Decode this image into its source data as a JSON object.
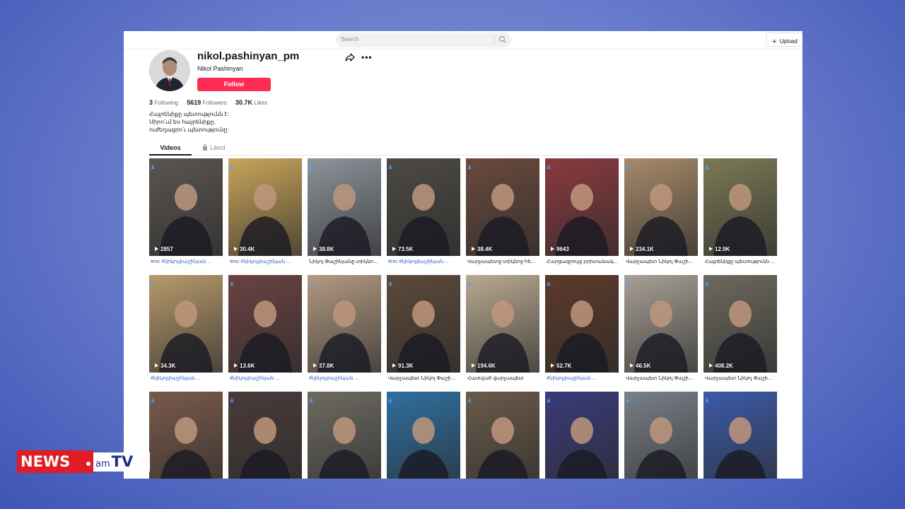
{
  "search": {
    "placeholder": "Search"
  },
  "header": {
    "upload_label": "Upload"
  },
  "profile": {
    "username": "nikol.pashinyan_pm",
    "nickname": "Nikol Pashinyan",
    "follow_label": "Follow",
    "stats": {
      "following_count": "3",
      "following_label": "Following",
      "followers_count": "5619",
      "followers_label": "Followers",
      "likes_count": "30.7K",
      "likes_label": "Likes"
    },
    "bio": [
      "Հայրենիքը պետությունն է:",
      "Սիրո՛ւմ ես հայրենիքը,",
      "ուժեղացրո՛ւ պետությունը:"
    ]
  },
  "tabs": {
    "videos": "Videos",
    "liked": "Liked"
  },
  "videos": [
    {
      "views": "2857",
      "caption": "#rec #նիկոլփաշինյան ...",
      "bg": "#5a5550"
    },
    {
      "views": "30.4K",
      "caption": "#rec #նիկոլփաշինյան ...",
      "bg": "#c9a55a"
    },
    {
      "views": "38.8K",
      "caption": "Նիկոլ Փաշինյանը տիկնո...",
      "bg": "#8e949c"
    },
    {
      "views": "73.5K",
      "caption": "#rec #նիկոլփաշինյան ...",
      "bg": "#4d4a44"
    },
    {
      "views": "38.4K",
      "caption": "Վարչապետը տիկնոջ հե...",
      "bg": "#6a4a3c"
    },
    {
      "views": "9643",
      "caption": "Հարցազրույց բրիտանակ...",
      "bg": "#8a3a3f"
    },
    {
      "views": "234.1K",
      "caption": "Վարչապետ Նիկոլ Փաշի...",
      "bg": "#a78a6a"
    },
    {
      "views": "12.9K",
      "caption": "Հայրենիքը պետությունն ...",
      "bg": "#7b7a55"
    },
    {
      "views": "34.3K",
      "caption": "#նիկոլփաշինյան ...",
      "bg": "#b89a6c"
    },
    {
      "views": "13.6K",
      "caption": "#նիկոլփաշինյան ...",
      "bg": "#6b4242"
    },
    {
      "views": "37.8K",
      "caption": "#նիկոլփաշինյան ...",
      "bg": "#b39a82"
    },
    {
      "views": "91.3K",
      "caption": "Վարչապետ Նիկոլ Փաշի...",
      "bg": "#5c4a3a"
    },
    {
      "views": "194.6K",
      "caption": "Հատված վարչապետ",
      "bg": "#b9aa92"
    },
    {
      "views": "52.7K",
      "caption": "#նիկոլփաշինյան ...",
      "bg": "#5c3a2a"
    },
    {
      "views": "46.5K",
      "caption": "Վարչապետ Նիկոլ Փաշի...",
      "bg": "#a8a096"
    },
    {
      "views": "408.2K",
      "caption": "Վարչապետ Նիկոլ Փաշի...",
      "bg": "#6d6a5e"
    },
    {
      "views": "",
      "caption": "",
      "bg": "#7a5a4a"
    },
    {
      "views": "",
      "caption": "",
      "bg": "#4a3a3a"
    },
    {
      "views": "",
      "caption": "",
      "bg": "#6e6a62"
    },
    {
      "views": "",
      "caption": "",
      "bg": "#2f6fa0"
    },
    {
      "views": "",
      "caption": "",
      "bg": "#6a5a4a"
    },
    {
      "views": "",
      "caption": "",
      "bg": "#3a3a7a"
    },
    {
      "views": "",
      "caption": "",
      "bg": "#7a8088"
    },
    {
      "views": "",
      "caption": "",
      "bg": "#3c5aa8"
    }
  ],
  "logo": {
    "news": "NEWS",
    "am": "am",
    "tv": "TV"
  },
  "colors": {
    "follow": "#fe2c55",
    "hashtag": "#2b5bb8",
    "logo_red": "#e11c24",
    "logo_blue": "#1a2f8c"
  }
}
